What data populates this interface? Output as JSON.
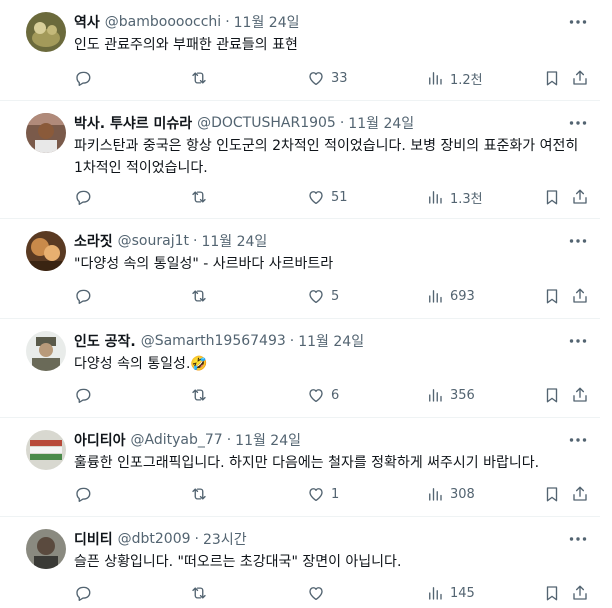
{
  "replies": [
    {
      "name": "역사",
      "handle": "@bamboooocchi",
      "time": "11월 24일",
      "text": "인도 관료주의와 부패한 관료들의 표현",
      "metrics": {
        "replies": "",
        "reposts": "",
        "likes": "33",
        "views": "1.2천"
      }
    },
    {
      "name": "박사. 투샤르 미슈라",
      "handle": "@DOCTUSHAR1905",
      "time": "11월 24일",
      "text": "파키스탄과 중국은 항상 인도군의 2차적인 적이었습니다. 보병 장비의 표준화가 여전히 1차적인 적이었습니다.",
      "metrics": {
        "replies": "",
        "reposts": "",
        "likes": "51",
        "views": "1.3천"
      }
    },
    {
      "name": "소라짓",
      "handle": "@souraj1t",
      "time": "11월 24일",
      "text": "\"다양성 속의 통일성\" - 사르바다 사르바트라",
      "metrics": {
        "replies": "",
        "reposts": "",
        "likes": "5",
        "views": "693"
      }
    },
    {
      "name": "인도 공작.",
      "handle": "@Samarth19567493",
      "time": "11월 24일",
      "text": "다양성 속의 통일성.🤣",
      "metrics": {
        "replies": "",
        "reposts": "",
        "likes": "6",
        "views": "356"
      }
    },
    {
      "name": "아디티아",
      "handle": "@Adityab_77",
      "time": "11월 24일",
      "text": "훌륭한 인포그래픽입니다. 하지만 다음에는 철자를 정확하게 써주시기 바랍니다.",
      "metrics": {
        "replies": "",
        "reposts": "",
        "likes": "1",
        "views": "308"
      }
    },
    {
      "name": "디비티",
      "handle": "@dbt2009",
      "time": "23시간",
      "text": "슬픈 상황입니다. \"떠오르는 초강대국\" 장면이 아닙니다.",
      "metrics": {
        "replies": "",
        "reposts": "",
        "likes": "",
        "views": "145"
      }
    }
  ],
  "icons": {
    "reply": "reply-icon",
    "repost": "repost-icon",
    "like": "heart-icon",
    "views": "views-icon",
    "bookmark": "bookmark-icon",
    "share": "share-icon",
    "more": "more-icon"
  },
  "colors": {
    "text": "#0f1419",
    "secondary": "#536471",
    "divider": "#eff3f4"
  }
}
